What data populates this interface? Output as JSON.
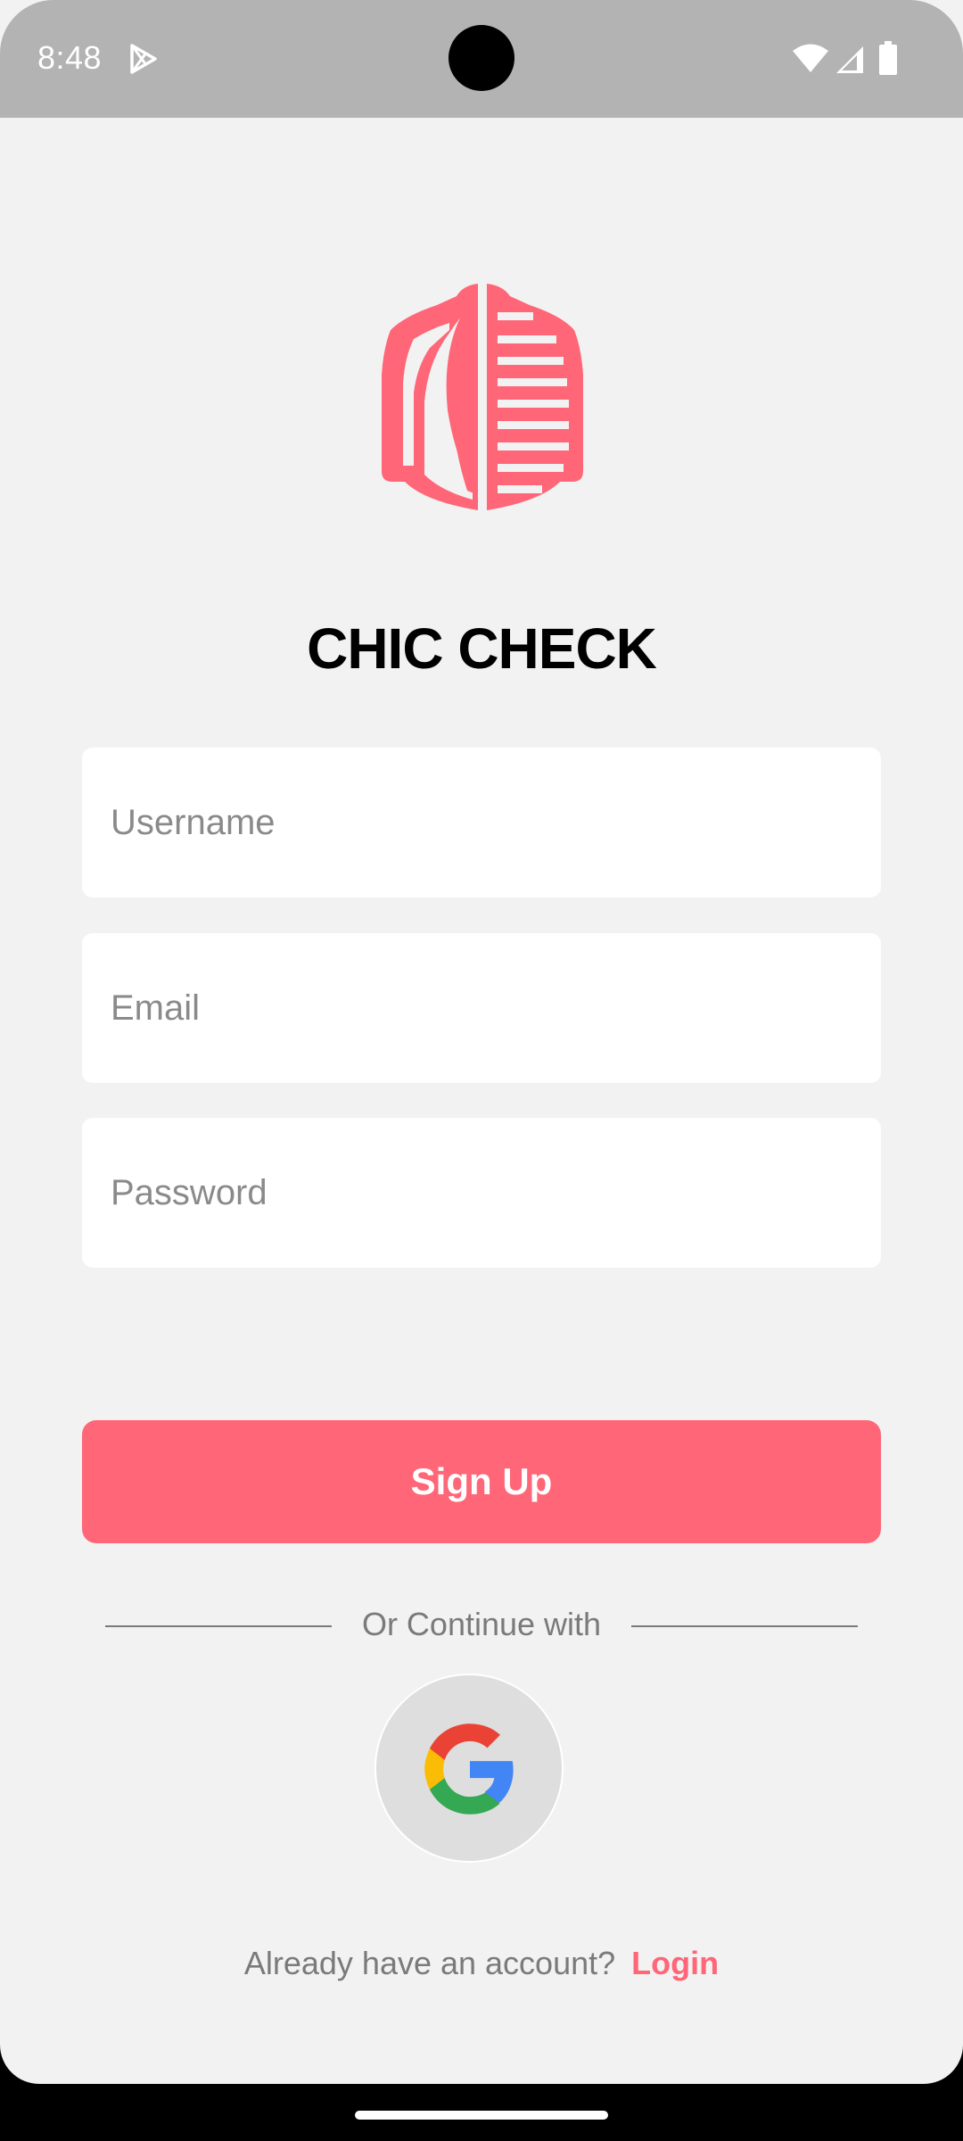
{
  "status_bar": {
    "time": "8:48",
    "icons": [
      "play-store-icon",
      "wifi-icon",
      "signal-icon",
      "battery-icon"
    ]
  },
  "app": {
    "logo_icon": "jacket-icon",
    "title": "CHIC CHECK"
  },
  "form": {
    "username_placeholder": "Username",
    "username_value": "",
    "email_placeholder": "Email",
    "email_value": "",
    "password_placeholder": "Password",
    "password_value": "",
    "signup_label": "Sign Up"
  },
  "social": {
    "divider_text": "Or Continue with",
    "google_icon": "google-icon"
  },
  "footer": {
    "prompt": "Already have an account?",
    "login_label": "Login"
  },
  "colors": {
    "accent": "#ff6677",
    "background": "#f2f2f2",
    "status_bar": "#b3b3b3",
    "field": "#ffffff",
    "muted_text": "#7a7a7a"
  }
}
